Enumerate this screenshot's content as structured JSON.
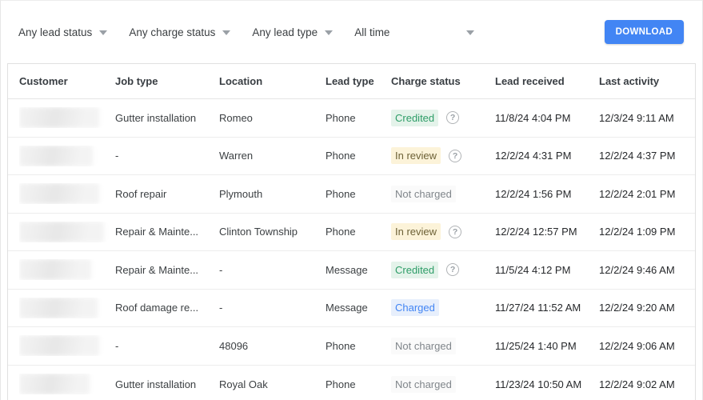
{
  "filterbar": {
    "filters": [
      {
        "label": "Any lead status"
      },
      {
        "label": "Any charge status"
      },
      {
        "label": "Any lead type"
      },
      {
        "label": "All time"
      }
    ],
    "download_label": "DOWNLOAD"
  },
  "table": {
    "columns": [
      "Customer",
      "Job type",
      "Location",
      "Lead type",
      "Charge status",
      "Lead received",
      "Last activity"
    ],
    "rows": [
      {
        "customer": "(blurred)",
        "job_type": "Gutter installation",
        "location": "Romeo",
        "lead_type": "Phone",
        "charge_status": "Credited",
        "has_help": true,
        "lead_received": "11/8/24 4:04 PM",
        "last_activity": "12/3/24 9:11 AM"
      },
      {
        "customer": "(blurred)",
        "job_type": "-",
        "location": "Warren",
        "lead_type": "Phone",
        "charge_status": "In review",
        "has_help": true,
        "lead_received": "12/2/24 4:31 PM",
        "last_activity": "12/2/24 4:37 PM"
      },
      {
        "customer": "(blurred)",
        "job_type": "Roof repair",
        "location": "Plymouth",
        "lead_type": "Phone",
        "charge_status": "Not charged",
        "has_help": false,
        "lead_received": "12/2/24 1:56 PM",
        "last_activity": "12/2/24 2:01 PM"
      },
      {
        "customer": "(blurred)",
        "job_type": "Repair & Mainte...",
        "location": "Clinton Township",
        "lead_type": "Phone",
        "charge_status": "In review",
        "has_help": true,
        "lead_received": "12/2/24 12:57 PM",
        "last_activity": "12/2/24 1:09 PM"
      },
      {
        "customer": "(blurred)",
        "job_type": "Repair & Mainte...",
        "location": "-",
        "lead_type": "Message",
        "charge_status": "Credited",
        "has_help": true,
        "lead_received": "11/5/24 4:12 PM",
        "last_activity": "12/2/24 9:46 AM"
      },
      {
        "customer": "(blurred)",
        "job_type": "Roof damage re...",
        "location": "-",
        "lead_type": "Message",
        "charge_status": "Charged",
        "has_help": false,
        "lead_received": "11/27/24 11:52 AM",
        "last_activity": "12/2/24 9:20 AM"
      },
      {
        "customer": "(blurred)",
        "job_type": "-",
        "location": "48096",
        "lead_type": "Phone",
        "charge_status": "Not charged",
        "has_help": false,
        "lead_received": "11/25/24 1:40 PM",
        "last_activity": "12/2/24 9:06 AM"
      },
      {
        "customer": "(blurred)",
        "job_type": "Gutter installation",
        "location": "Royal Oak",
        "lead_type": "Phone",
        "charge_status": "Not charged",
        "has_help": false,
        "lead_received": "11/23/24 10:50 AM",
        "last_activity": "12/2/24 9:02 AM"
      }
    ],
    "help_icon_glyph": "?"
  },
  "colors": {
    "accent_blue": "#4285f4",
    "credited_bg": "#e4f3ea",
    "credited_text": "#2e9d68",
    "in_review_bg": "#fcf3d9",
    "in_review_text": "#6d6136",
    "charged_bg": "#e7effc",
    "charged_text": "#4285f4",
    "not_charged_text": "#80868b"
  }
}
